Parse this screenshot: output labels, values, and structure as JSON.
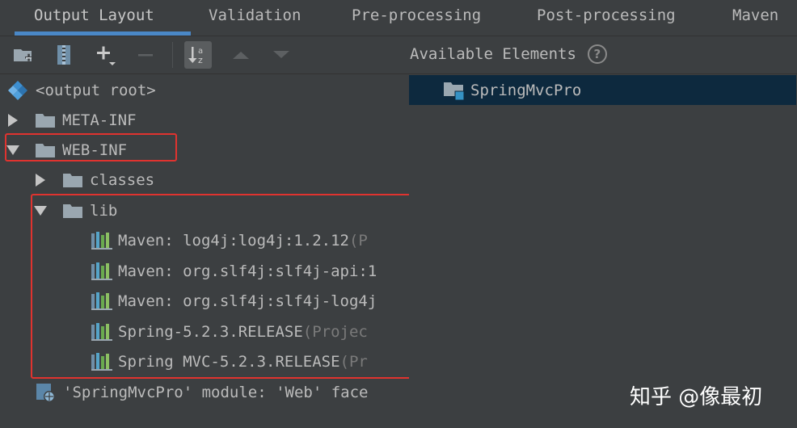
{
  "tabs": [
    {
      "label": "Output Layout",
      "active": true
    },
    {
      "label": "Validation",
      "active": false
    },
    {
      "label": "Pre-processing",
      "active": false
    },
    {
      "label": "Post-processing",
      "active": false
    },
    {
      "label": "Maven",
      "active": false
    }
  ],
  "toolbar": {
    "buttons": [
      {
        "icon": "new-folder-icon"
      },
      {
        "icon": "archive-icon"
      },
      {
        "icon": "add-icon"
      },
      {
        "icon": "remove-icon"
      },
      {
        "icon": "sort-alpha-icon",
        "pressed": true
      },
      {
        "icon": "move-up-icon"
      },
      {
        "icon": "move-down-icon"
      }
    ]
  },
  "available": {
    "header": "Available Elements",
    "help": "?",
    "items": [
      {
        "label": "SpringMvcPro",
        "selected": true,
        "icon": "module-folder-icon"
      }
    ]
  },
  "tree": {
    "root": {
      "label": "<output root>",
      "icon": "output-root-icon"
    },
    "meta_inf": {
      "label": "META-INF",
      "expanded": false
    },
    "web_inf": {
      "label": "WEB-INF",
      "expanded": true
    },
    "classes": {
      "label": "classes",
      "expanded": false
    },
    "lib": {
      "label": "lib",
      "expanded": true
    },
    "libs": [
      {
        "label": "Maven: log4j:log4j:1.2.12",
        "suffix": " (P"
      },
      {
        "label": "Maven: org.slf4j:slf4j-api:1",
        "suffix": ""
      },
      {
        "label": "Maven: org.slf4j:slf4j-log4j",
        "suffix": ""
      },
      {
        "label": "Spring-5.2.3.RELEASE",
        "suffix": " (Projec"
      },
      {
        "label": "Spring MVC-5.2.3.RELEASE",
        "suffix": " (Pr"
      }
    ],
    "facet": {
      "label": "'SpringMvcPro' module: 'Web' face"
    }
  },
  "colors": {
    "background": "#3c3f41",
    "accent": "#4a88c7",
    "highlight_box": "#e0332f",
    "selection": "#0d293e"
  },
  "watermark": "知乎 @像最初"
}
